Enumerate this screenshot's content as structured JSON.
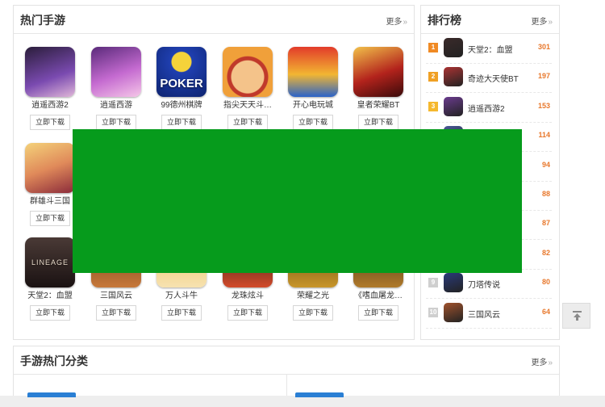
{
  "hot_games": {
    "title": "热门手游",
    "more_label": "更多",
    "games": [
      {
        "name": "逍遥西游2",
        "download_label": "立即下载",
        "icon": "xiaoyao-xiyou2-icon",
        "color": "#6a3b8e"
      },
      {
        "name": "逍遥西游",
        "download_label": "立即下载",
        "icon": "xiaoyao-xiyou-icon",
        "color": "#b45ab8"
      },
      {
        "name": "99德州棋牌",
        "download_label": "立即下载",
        "icon": "poker-icon",
        "color": "#2647a8"
      },
      {
        "name": "指尖天天斗…",
        "download_label": "立即下载",
        "icon": "doudizhu-icon",
        "color": "#e28a2c"
      },
      {
        "name": "开心电玩城",
        "download_label": "立即下载",
        "icon": "arcade-icon",
        "color": "#c9302c"
      },
      {
        "name": "皇者荣耀BT",
        "download_label": "立即下载",
        "icon": "glory-icon",
        "color": "#8b1a1a"
      },
      {
        "name": "群雄斗三国",
        "download_label": "立即下载",
        "icon": "sanguo-hero-icon",
        "color": "#d9a23a"
      },
      {
        "name": "天堂2：血盟",
        "download_label": "立即下载",
        "icon": "lineage-icon",
        "color": "#3a2a2a"
      },
      {
        "name": "三国风云",
        "download_label": "立即下载",
        "icon": "sanguo-fengyun-icon",
        "color": "#a0522d"
      },
      {
        "name": "万人斗牛",
        "download_label": "立即下载",
        "icon": "douniu-icon",
        "color": "#d4a017"
      },
      {
        "name": "龙珠炫斗",
        "download_label": "立即下载",
        "icon": "dragonball-icon",
        "color": "#2b2b2b"
      },
      {
        "name": "荣耀之光",
        "download_label": "立即下载",
        "icon": "glory-light-icon",
        "color": "#b8860b"
      },
      {
        "name": "《嗜血屠龙…",
        "download_label": "立即下载",
        "icon": "dragon-slayer-icon",
        "color": "#7a4a1a"
      }
    ],
    "lineage_logo_text": "LINEAGE"
  },
  "ranking": {
    "title": "排行榜",
    "more_label": "更多",
    "items": [
      {
        "rank": "1",
        "name": "天堂2：血盟",
        "score": "301",
        "badge_color": "#f08a24",
        "icon_color": "#3a2a2a"
      },
      {
        "rank": "2",
        "name": "奇迹大天使BT",
        "score": "197",
        "badge_color": "#f0a024",
        "icon_color": "#a33"
      },
      {
        "rank": "3",
        "name": "逍遥西游2",
        "score": "153",
        "badge_color": "#f5b82e",
        "icon_color": "#6a3b8e"
      },
      {
        "rank": "",
        "name": "",
        "score": "114",
        "badge_color": "#cfcfcf",
        "icon_color": "#4a5a9a"
      },
      {
        "rank": "",
        "name": "",
        "score": "94",
        "badge_color": "#cfcfcf",
        "icon_color": "#cccccc"
      },
      {
        "rank": "",
        "name": "",
        "score": "88",
        "badge_color": "#cfcfcf",
        "icon_color": "#cccccc"
      },
      {
        "rank": "",
        "name": "",
        "score": "87",
        "badge_color": "#cfcfcf",
        "icon_color": "#cccccc"
      },
      {
        "rank": "",
        "name": "",
        "score": "82",
        "badge_color": "#cfcfcf",
        "icon_color": "#cccccc"
      },
      {
        "rank": "9",
        "name": "刀塔传说",
        "score": "80",
        "badge_color": "#cfcfcf",
        "icon_color": "#2a3a7a"
      },
      {
        "rank": "10",
        "name": "三国风云",
        "score": "64",
        "badge_color": "#cfcfcf",
        "icon_color": "#a0522d"
      }
    ]
  },
  "categories": {
    "title": "手游热门分类",
    "more_label": "更多"
  },
  "colors": {
    "overlay": "#069b1c",
    "score": "#e8782c",
    "category_tab": "#2a7fd4"
  }
}
